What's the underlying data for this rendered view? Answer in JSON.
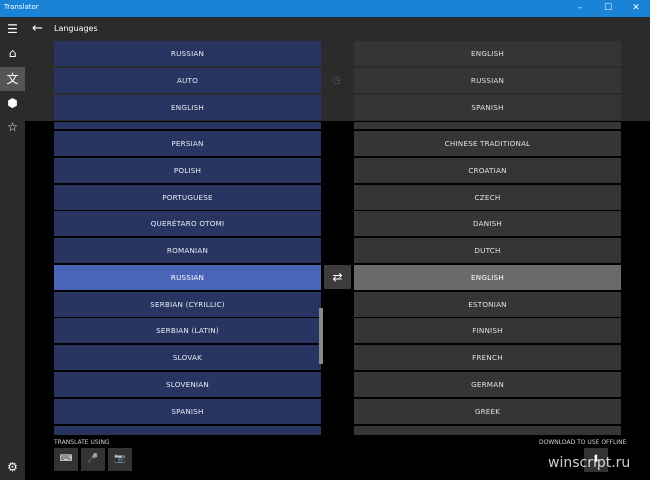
{
  "window": {
    "title": "Translator",
    "controls": [
      "–",
      "☐",
      "✕"
    ]
  },
  "header": {
    "title": "Languages",
    "back_icon": "←"
  },
  "sidebar": {
    "menu_icon": "☰",
    "home_icon": "⌂",
    "translate_icon": "文",
    "phrasebook_icon": "⬢",
    "favorites_icon": "☆",
    "settings_icon": "⚙"
  },
  "recent": {
    "from": [
      "RUSSIAN",
      "AUTO",
      "ENGLISH"
    ],
    "to": [
      "ENGLISH",
      "RUSSIAN",
      "SPANISH"
    ]
  },
  "from_languages": [
    "",
    "PERSIAN",
    "POLISH",
    "PORTUGUESE",
    "QUERÉTARO OTOMI",
    "ROMANIAN",
    "RUSSIAN",
    "SERBIAN (CYRILLIC)",
    "SERBIAN (LATIN)",
    "SLOVAK",
    "SLOVENIAN",
    "SPANISH",
    ""
  ],
  "to_languages": [
    "",
    "CHINESE TRADITIONAL",
    "CROATIAN",
    "CZECH",
    "DANISH",
    "DUTCH",
    "ENGLISH",
    "ESTONIAN",
    "FINNISH",
    "FRENCH",
    "GERMAN",
    "GREEK",
    ""
  ],
  "selected": {
    "from": "RUSSIAN",
    "to": "ENGLISH"
  },
  "swap_icon": "⇄",
  "footer": {
    "translate_using": "TRANSLATE USING",
    "download_offline": "DOWNLOAD TO USE OFFLINE",
    "keyboard_icon": "⌨",
    "mic_icon": "🎤",
    "camera_icon": "📷",
    "download_icon": "⬇"
  },
  "watermark": "winscript.ru",
  "colors": {
    "accent": "#1883d7",
    "from_bg": "#273560",
    "from_selected": "#4a65b8",
    "to_bg": "#353535",
    "to_selected": "#6a6a6a"
  }
}
